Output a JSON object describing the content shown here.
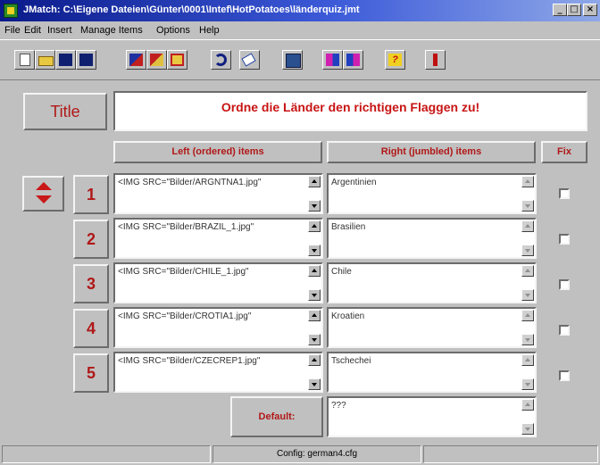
{
  "window": {
    "title": "JMatch: C:\\Eigene Dateien\\Günter\\0001\\Intef\\HotPotatoes\\länderquiz.jmt"
  },
  "menu": [
    "File",
    "Edit",
    "Insert",
    "Manage Items",
    "Options",
    "Help"
  ],
  "toolbar_icons": [
    "new-file-icon",
    "open-folder-icon",
    "save-icon",
    "save-as-icon",
    "cut-icon",
    "copy-icon",
    "paste-icon",
    "undo-icon",
    "eraser-icon",
    "web-page-icon",
    "export-left-icon",
    "export-right-icon",
    "help-icon",
    "exit-icon"
  ],
  "title_label": "Title",
  "title_value": "Ordne die Länder den richtigen Flaggen zu!",
  "headers": {
    "left": "Left (ordered) items",
    "right": "Right (jumbled) items",
    "fix": "Fix"
  },
  "rows": [
    {
      "num": "1",
      "left": "<IMG SRC=\"Bilder/ARGNTNA1.jpg\"",
      "right": "Argentinien"
    },
    {
      "num": "2",
      "left": "<IMG SRC=\"Bilder/BRAZIL_1.jpg\"",
      "right": "Brasilien"
    },
    {
      "num": "3",
      "left": "<IMG SRC=\"Bilder/CHILE_1.jpg\"",
      "right": "Chile"
    },
    {
      "num": "4",
      "left": "<IMG SRC=\"Bilder/CROTIA1.jpg\"",
      "right": "Kroatien"
    },
    {
      "num": "5",
      "left": "<IMG SRC=\"Bilder/CZECREP1.jpg\"",
      "right": "Tschechei"
    }
  ],
  "default_label": "Default:",
  "default_value": "???",
  "status": {
    "config": "Config: german4.cfg"
  }
}
